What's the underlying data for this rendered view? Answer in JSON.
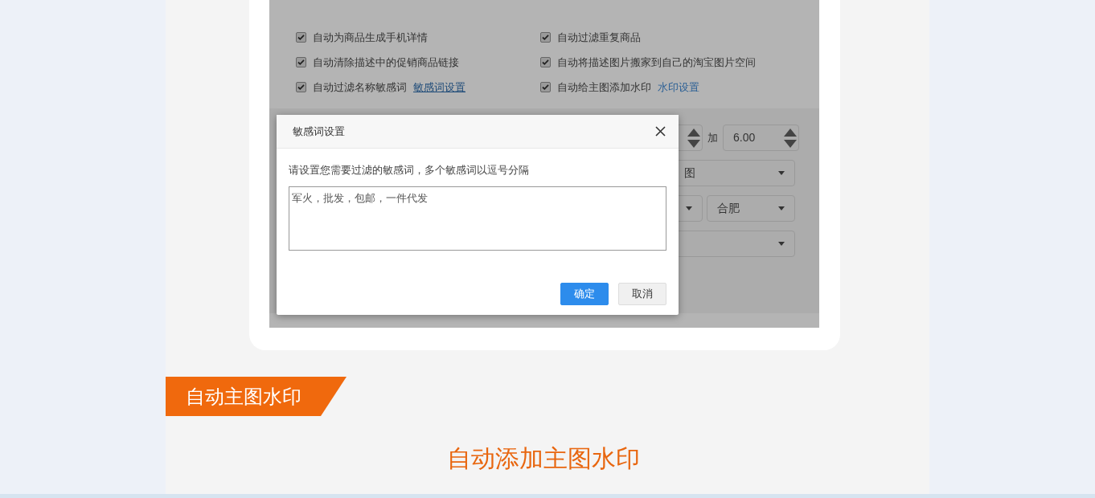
{
  "options": [
    {
      "label": "自动为商品生成手机详情",
      "checked": true
    },
    {
      "label": "自动过滤重复商品",
      "checked": true
    },
    {
      "label": "自动清除描述中的促销商品链接",
      "checked": true
    },
    {
      "label": "自动将描述图片搬家到自己的淘宝图片空间",
      "checked": true
    },
    {
      "label": "自动过滤名称敏感词",
      "checked": true,
      "link": "敏感词设置"
    },
    {
      "label": "自动给主图添加水印",
      "checked": true,
      "link": "水印设置"
    }
  ],
  "background_form": [
    [
      {
        "kind": "spinner",
        "cut_off": true
      },
      {
        "kind": "label",
        "text": "加"
      },
      {
        "kind": "spinner",
        "value": "6.00"
      }
    ],
    [
      {
        "kind": "select",
        "value": "图"
      }
    ],
    [
      {
        "kind": "select",
        "cut_off": true
      },
      {
        "kind": "select",
        "value": "合肥"
      }
    ],
    [
      {
        "kind": "select"
      }
    ]
  ],
  "dialog": {
    "title": "敏感词设置",
    "instruction": "请设置您需要过滤的敏感词，多个敏感词以逗号分隔",
    "textarea_value": "军火，批发，包邮，一件代发",
    "buttons": [
      {
        "label": "确定",
        "kind": "primary"
      },
      {
        "label": "取消",
        "kind": "secondary"
      }
    ]
  },
  "section_banner": "自动主图水印",
  "section_heading": "自动添加主图水印"
}
